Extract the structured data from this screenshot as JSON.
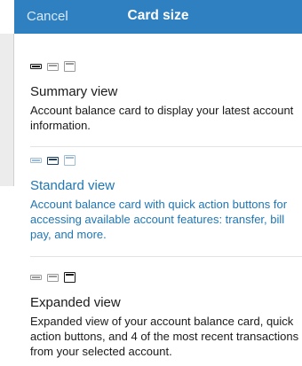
{
  "header": {
    "cancel_label": "Cancel",
    "title": "Card size",
    "background": "#2e80c0"
  },
  "options": [
    {
      "title": "Summary view",
      "description": "Account balance card to display your latest account information.",
      "icons": [
        "card-small-icon",
        "card-medium-icon",
        "card-large-icon"
      ],
      "selected_icon": 0,
      "selected": false
    },
    {
      "title": "Standard view",
      "description": "Account balance card with quick action buttons for accessing available account features: transfer, bill pay, and more.",
      "icons": [
        "card-small-icon",
        "card-medium-icon",
        "card-large-icon"
      ],
      "selected_icon": 1,
      "selected": true
    },
    {
      "title": "Expanded view",
      "description": "Expanded view of your account balance card, quick action buttons, and 4 of the most recent transactions from your selected account.",
      "icons": [
        "card-small-icon",
        "card-medium-icon",
        "card-large-icon"
      ],
      "selected_icon": 2,
      "selected": false
    }
  ],
  "colors": {
    "accent": "#1e76b5",
    "text": "#1a1a1a",
    "divider": "#e3e3e3"
  }
}
